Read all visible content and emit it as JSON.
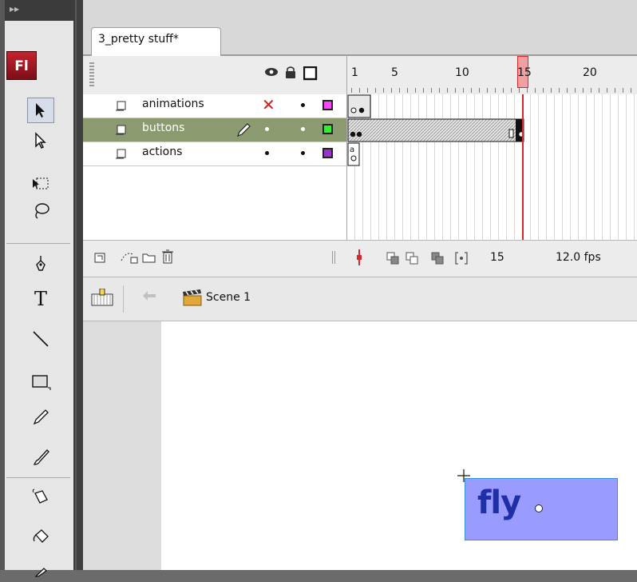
{
  "tools": {
    "header_glyph": "▸▸",
    "logo": "Fl",
    "items": [
      {
        "name": "selection-tool",
        "icon": "selection-arrow-icon",
        "selected": true
      },
      {
        "name": "subselection-tool",
        "icon": "subselection-arrow-icon"
      },
      {
        "name": "free-transform-tool",
        "icon": "free-transform-icon"
      },
      {
        "name": "lasso-tool",
        "icon": "lasso-icon"
      },
      {
        "name": "pen-tool",
        "icon": "pen-icon"
      },
      {
        "name": "text-tool",
        "icon": "text-icon",
        "glyph": "T"
      },
      {
        "name": "line-tool",
        "icon": "line-icon"
      },
      {
        "name": "rectangle-tool",
        "icon": "rectangle-icon"
      },
      {
        "name": "pencil-tool",
        "icon": "pencil-icon"
      },
      {
        "name": "brush-tool",
        "icon": "brush-icon"
      },
      {
        "name": "ink-bottle-tool",
        "icon": "ink-bottle-icon"
      },
      {
        "name": "paint-bucket-tool",
        "icon": "paint-bucket-icon"
      }
    ]
  },
  "document": {
    "tab_title": "3_pretty stuff*"
  },
  "timeline": {
    "frame_numbers": [
      "1",
      "5",
      "10",
      "15",
      "20"
    ],
    "current_frame": "15",
    "layers": [
      {
        "name": "animations",
        "hidden": true,
        "outline_color": "#ff44ff"
      },
      {
        "name": "buttons",
        "selected": true,
        "outline_color": "#33ee33"
      },
      {
        "name": "actions",
        "outline_color": "#9a33cc"
      }
    ],
    "status": {
      "current_frame": "15",
      "frame_rate": "12.0 fps"
    }
  },
  "edit_bar": {
    "scene_label": "Scene 1"
  },
  "stage": {
    "button_text": "fly",
    "button_fill": "#9a9bff",
    "text_color": "#1f2fa5"
  }
}
